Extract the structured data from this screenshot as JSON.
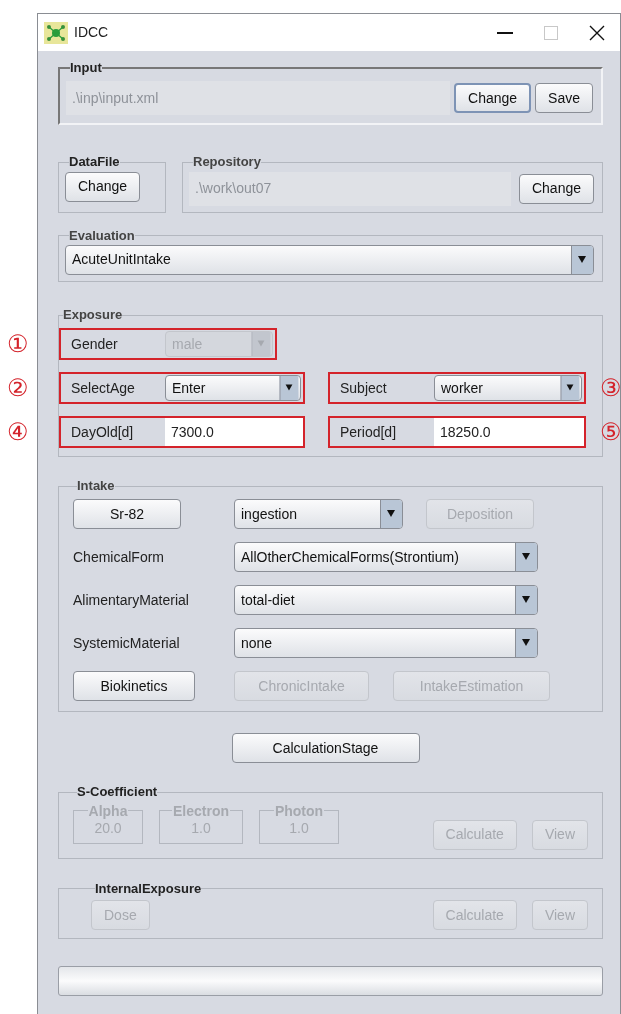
{
  "window": {
    "title": "IDCC"
  },
  "input": {
    "legend": "Input",
    "path": ".\\inp\\input.xml",
    "path_disabled": true,
    "buttons": [
      {
        "label": "Change",
        "focused": true,
        "disabled": false
      },
      {
        "label": "Save",
        "focused": false,
        "disabled": false
      }
    ]
  },
  "datafile": {
    "legend": "DataFile",
    "button": {
      "label": "Change",
      "disabled": false
    }
  },
  "repository": {
    "legend": "Repository",
    "path": ".\\work\\out07",
    "path_disabled": true,
    "button": {
      "label": "Change",
      "disabled": false
    }
  },
  "evaluation": {
    "legend": "Evaluation",
    "value": "AcuteUnitIntake",
    "disabled": false
  },
  "exposure": {
    "legend": "Exposure",
    "rows": [
      [
        {
          "callout": "①",
          "label": "Gender",
          "kind": "dropdown",
          "value": "male",
          "disabled": true
        }
      ],
      [
        {
          "callout": "②",
          "label": "SelectAge",
          "kind": "dropdown",
          "value": "Enter",
          "disabled": false
        },
        {
          "callout": "③",
          "label": "Subject",
          "kind": "dropdown",
          "value": "worker",
          "disabled": false
        }
      ],
      [
        {
          "callout": "④",
          "label": "DayOld[d]",
          "kind": "text",
          "value": "7300.0",
          "disabled": false
        },
        {
          "callout": "⑤",
          "label": "Period[d]",
          "kind": "text",
          "value": "18250.0",
          "disabled": false
        }
      ]
    ]
  },
  "intake": {
    "legend": "Intake",
    "top": [
      {
        "kind": "button",
        "label": "Sr-82",
        "disabled": false
      },
      {
        "kind": "dropdown",
        "value": "ingestion",
        "disabled": false
      },
      {
        "kind": "button",
        "label": "Deposition",
        "disabled": true
      }
    ],
    "materials": [
      {
        "label": "ChemicalForm",
        "value": "AllOtherChemicalForms(Strontium)",
        "disabled": false
      },
      {
        "label": "AlimentaryMaterial",
        "value": "total-diet",
        "disabled": false
      },
      {
        "label": "SystemicMaterial",
        "value": "none",
        "disabled": false
      }
    ],
    "buttons": [
      {
        "label": "Biokinetics",
        "disabled": false
      },
      {
        "label": "ChronicIntake",
        "disabled": true
      },
      {
        "label": "IntakeEstimation",
        "disabled": true
      }
    ]
  },
  "calculation_stage": {
    "label": "CalculationStage",
    "disabled": false
  },
  "s_coefficient": {
    "legend": "S-Coefficient",
    "coefficients": [
      {
        "label": "Alpha",
        "value": "20.0",
        "disabled": true
      },
      {
        "label": "Electron",
        "value": "1.0",
        "disabled": true
      },
      {
        "label": "Photon",
        "value": "1.0",
        "disabled": true
      }
    ],
    "buttons": [
      {
        "label": "Calculate",
        "disabled": true
      },
      {
        "label": "View",
        "disabled": true
      }
    ]
  },
  "internal_exposure": {
    "legend": "InternalExposure",
    "left_button": {
      "label": "Dose",
      "disabled": true
    },
    "buttons": [
      {
        "label": "Calculate",
        "disabled": true
      },
      {
        "label": "View",
        "disabled": true
      }
    ]
  },
  "progress": {
    "level": 0
  }
}
